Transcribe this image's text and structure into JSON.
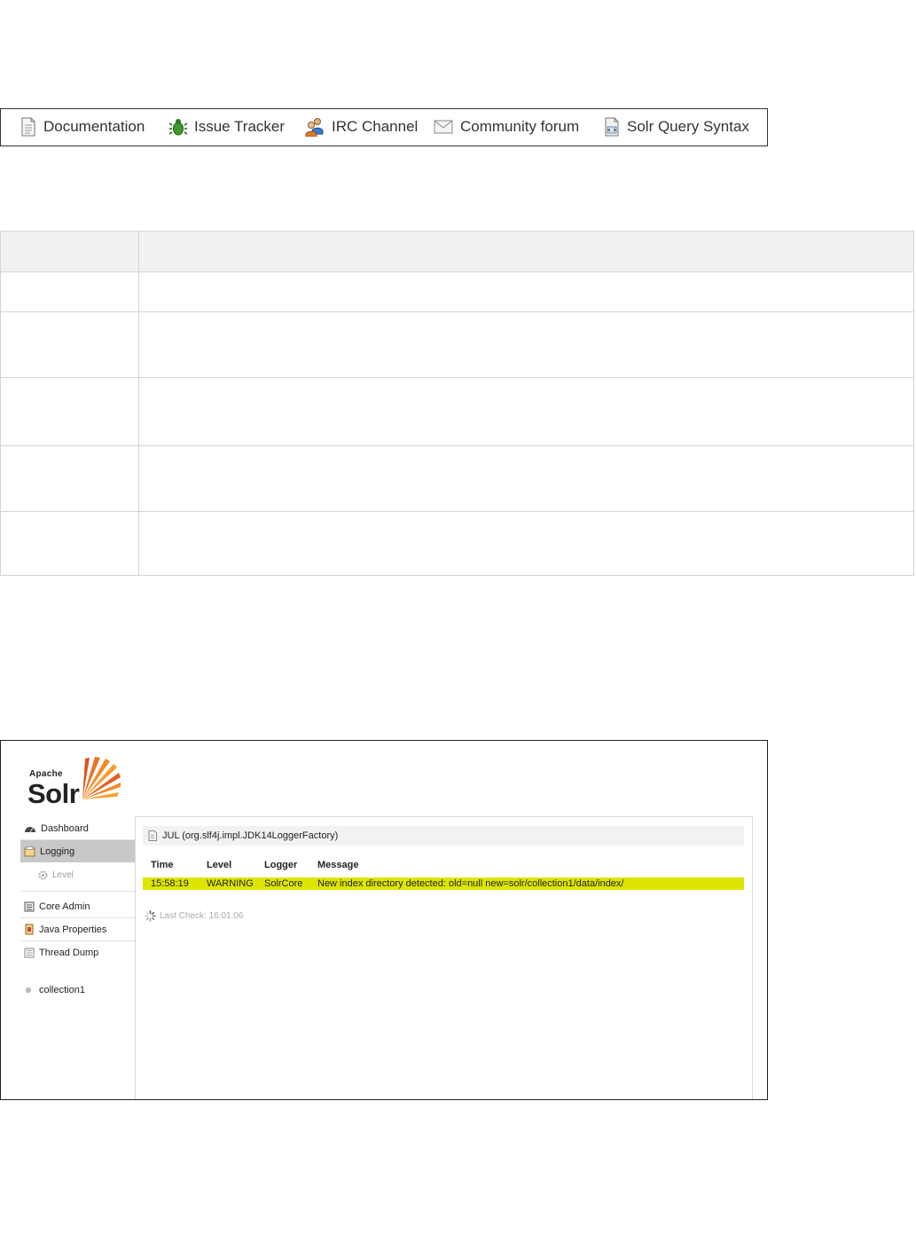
{
  "links": [
    {
      "label": "Documentation",
      "icon": "document-icon"
    },
    {
      "label": "Issue Tracker",
      "icon": "bug-icon"
    },
    {
      "label": "IRC Channel",
      "icon": "people-icon"
    },
    {
      "label": "Community forum",
      "icon": "mail-icon"
    },
    {
      "label": "Solr Query Syntax",
      "icon": "query-doc-icon"
    }
  ],
  "solr": {
    "logo": {
      "apache": "Apache",
      "solr": "Solr"
    },
    "nav": {
      "dashboard": "Dashboard",
      "logging": "Logging",
      "level": "Level",
      "core_admin": "Core Admin",
      "java_properties": "Java Properties",
      "thread_dump": "Thread Dump",
      "collection": "collection1"
    },
    "logging": {
      "title": "JUL (org.slf4j.impl.JDK14LoggerFactory)",
      "headers": {
        "time": "Time",
        "level": "Level",
        "logger": "Logger",
        "message": "Message"
      },
      "row": {
        "time": "15:58:19",
        "level": "WARNING",
        "logger": "SolrCore",
        "message": "New index directory detected: old=null new=solr/collection1/data/index/"
      },
      "last_check": "Last Check: 16:01:06"
    }
  },
  "colors": {
    "warning_row": "#dde500",
    "active_nav": "#c8c8c8"
  }
}
